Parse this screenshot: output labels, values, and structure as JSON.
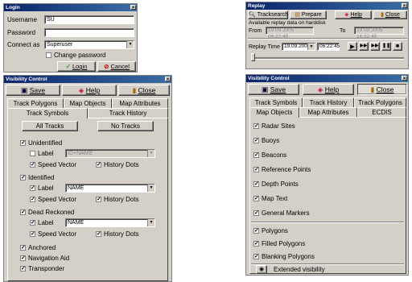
{
  "login": {
    "title": "Login",
    "username_label": "Username",
    "username_value": "SU",
    "password_label": "Password",
    "password_value": "",
    "connect_label": "Connect as",
    "connect_value": "Superuser",
    "change_password": "Change password",
    "login_btn": "Login",
    "cancel_btn": "Cancel"
  },
  "vis_left": {
    "title": "Visibility Control",
    "save": "Save",
    "help": "Help",
    "close": "Close",
    "tabs_row1": [
      "Track Polygons",
      "Map Objects",
      "Map Attributes"
    ],
    "tabs_row2": [
      "Track Symbols",
      "Track History"
    ],
    "all_tracks": "All Tracks",
    "no_tracks": "No Tracks",
    "groups": [
      {
        "name": "Unidentified",
        "label": "Label",
        "label_value": "ID+NAME",
        "speed": "Speed Vector",
        "history": "History Dots"
      },
      {
        "name": "Identified",
        "label": "Label",
        "label_value": "NAME",
        "speed": "Speed Vector",
        "history": "History Dots"
      },
      {
        "name": "Dead Reckoned",
        "label": "Label",
        "label_value": "NAME",
        "speed": "Speed Vector",
        "history": "History Dots"
      }
    ],
    "extra": [
      "Anchored",
      "Navigation Aid",
      "Transponder"
    ]
  },
  "replay": {
    "title": "Replay",
    "trackseach": "Tracksearch",
    "prepare": "Prepare",
    "help": "Help",
    "close": "Close",
    "available": "Available replay data on harddisk",
    "from_label": "From",
    "from_value": "19.09.2005 06:22:45",
    "to_label": "To",
    "to_value": "19.09.2005 16:22:45",
    "replay_time_label": "Replay Time",
    "date_value": "19.09.2005",
    "time_value": "06:22:45"
  },
  "vis_right": {
    "title": "Visibility Control",
    "save": "Save",
    "help": "Help",
    "close": "Close",
    "tabs_row1": [
      "Track Symbols",
      "Track History",
      "Track Polygons"
    ],
    "tabs_row2": [
      "Map Objects",
      "Map Attributes",
      "ECDIS"
    ],
    "items1": [
      "Radar Sites",
      "Buoys",
      "Beacons",
      "Reference Points",
      "Depth Points",
      "Map Text",
      "General Markers"
    ],
    "items2": [
      "Polygons",
      "Filled Polygons",
      "Blanking Polygons"
    ],
    "extended": "Extended visibility"
  }
}
